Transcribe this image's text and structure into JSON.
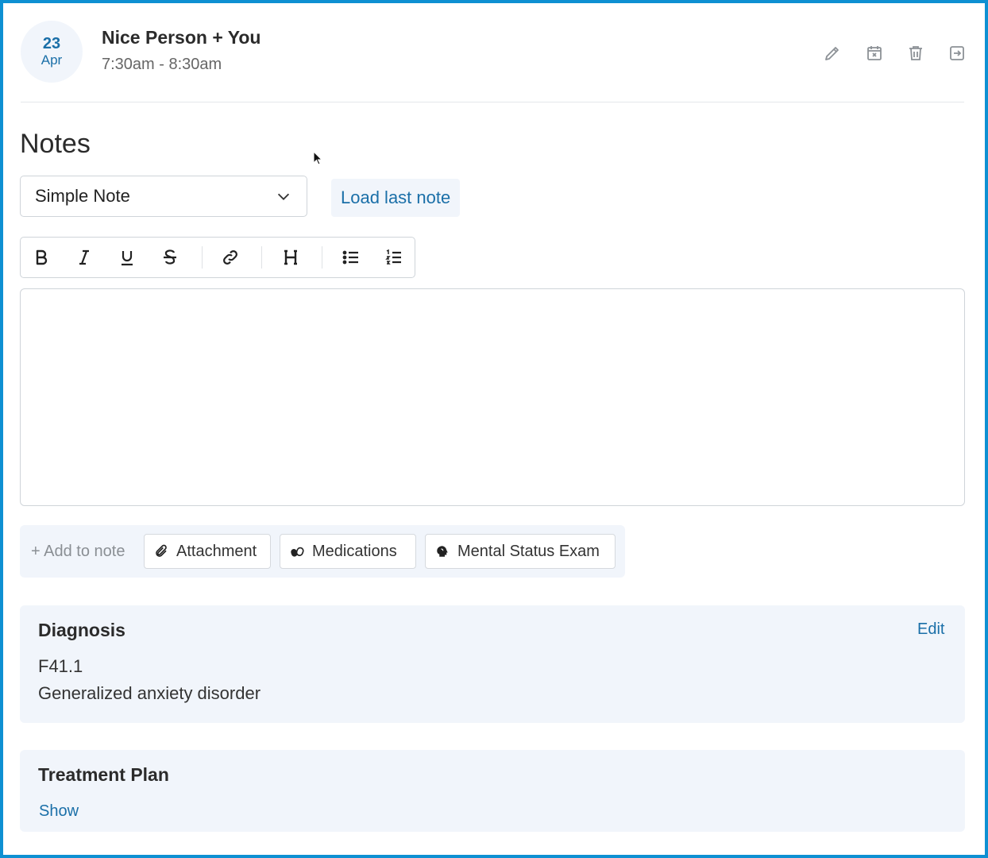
{
  "appointment": {
    "day": "23",
    "month": "Apr",
    "title": "Nice Person + You",
    "time": "7:30am - 8:30am"
  },
  "header_icons": [
    "pencil-icon",
    "calendar-x-icon",
    "trash-icon",
    "exit-icon"
  ],
  "notes": {
    "title": "Notes",
    "template_selected": "Simple Note",
    "load_last_label": "Load last note",
    "toolbar": [
      "bold",
      "italic",
      "underline",
      "strikethrough",
      "link",
      "heading",
      "bullet-list",
      "numbered-list"
    ],
    "editor_content": ""
  },
  "add_to_note": {
    "label": "+ Add to note",
    "items": [
      {
        "label": "Attachment",
        "icon": "paperclip-icon"
      },
      {
        "label": "Medications",
        "icon": "pills-icon"
      },
      {
        "label": "Mental Status Exam",
        "icon": "brain-icon"
      }
    ]
  },
  "diagnosis": {
    "title": "Diagnosis",
    "edit_label": "Edit",
    "code": "F41.1",
    "description": "Generalized anxiety disorder"
  },
  "treatment_plan": {
    "title": "Treatment Plan",
    "show_label": "Show"
  },
  "colors": {
    "accent": "#1a6fa8",
    "frame": "#0e90d2",
    "panel_bg": "#f1f5fb"
  }
}
